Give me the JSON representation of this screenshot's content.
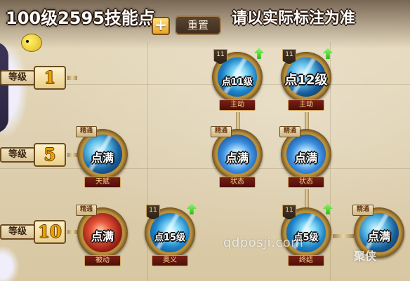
{
  "header": {
    "skill_points_text": "100级2595技能点",
    "plus_label": "+",
    "reset_label": "重置",
    "note_text": "请以实际标注为准"
  },
  "levels": [
    {
      "label": "等级",
      "value": "1"
    },
    {
      "label": "等级",
      "value": "5"
    },
    {
      "label": "等级",
      "value": "10"
    }
  ],
  "skills": [
    {
      "id": "s1",
      "row": 1,
      "level_badge": "11",
      "upgradeable": true,
      "overlay": "点11级",
      "banner": "主动",
      "art": "blue"
    },
    {
      "id": "s2",
      "row": 1,
      "level_badge": "11",
      "upgradeable": true,
      "overlay": "点12级",
      "banner": "主动",
      "art": "storm"
    },
    {
      "id": "s3",
      "row": 5,
      "tag": "精通",
      "overlay": "点满",
      "banner": "天赋",
      "art": "storm"
    },
    {
      "id": "s4",
      "row": 5,
      "tag": "精通",
      "overlay": "点满",
      "banner": "状态",
      "art": "burst"
    },
    {
      "id": "s5",
      "row": 5,
      "tag": "精通",
      "overlay": "点满",
      "banner": "状态",
      "art": "burst"
    },
    {
      "id": "s6",
      "row": 10,
      "tag": "精通",
      "overlay": "点满",
      "banner": "被动",
      "art": "red"
    },
    {
      "id": "s7",
      "row": 10,
      "level_badge": "11",
      "upgradeable": true,
      "overlay": "点15级",
      "banner": "奥义",
      "art": "blue"
    },
    {
      "id": "s8",
      "row": 10,
      "level_badge": "11",
      "upgradeable": true,
      "overlay": "点5级",
      "banner": "终结",
      "art": "blue"
    },
    {
      "id": "s9",
      "row": 10,
      "tag": "精通",
      "overlay": "点满",
      "banner": "",
      "art": "storm"
    }
  ],
  "watermark": "qdposji.com",
  "corner_mark": "聚侠"
}
